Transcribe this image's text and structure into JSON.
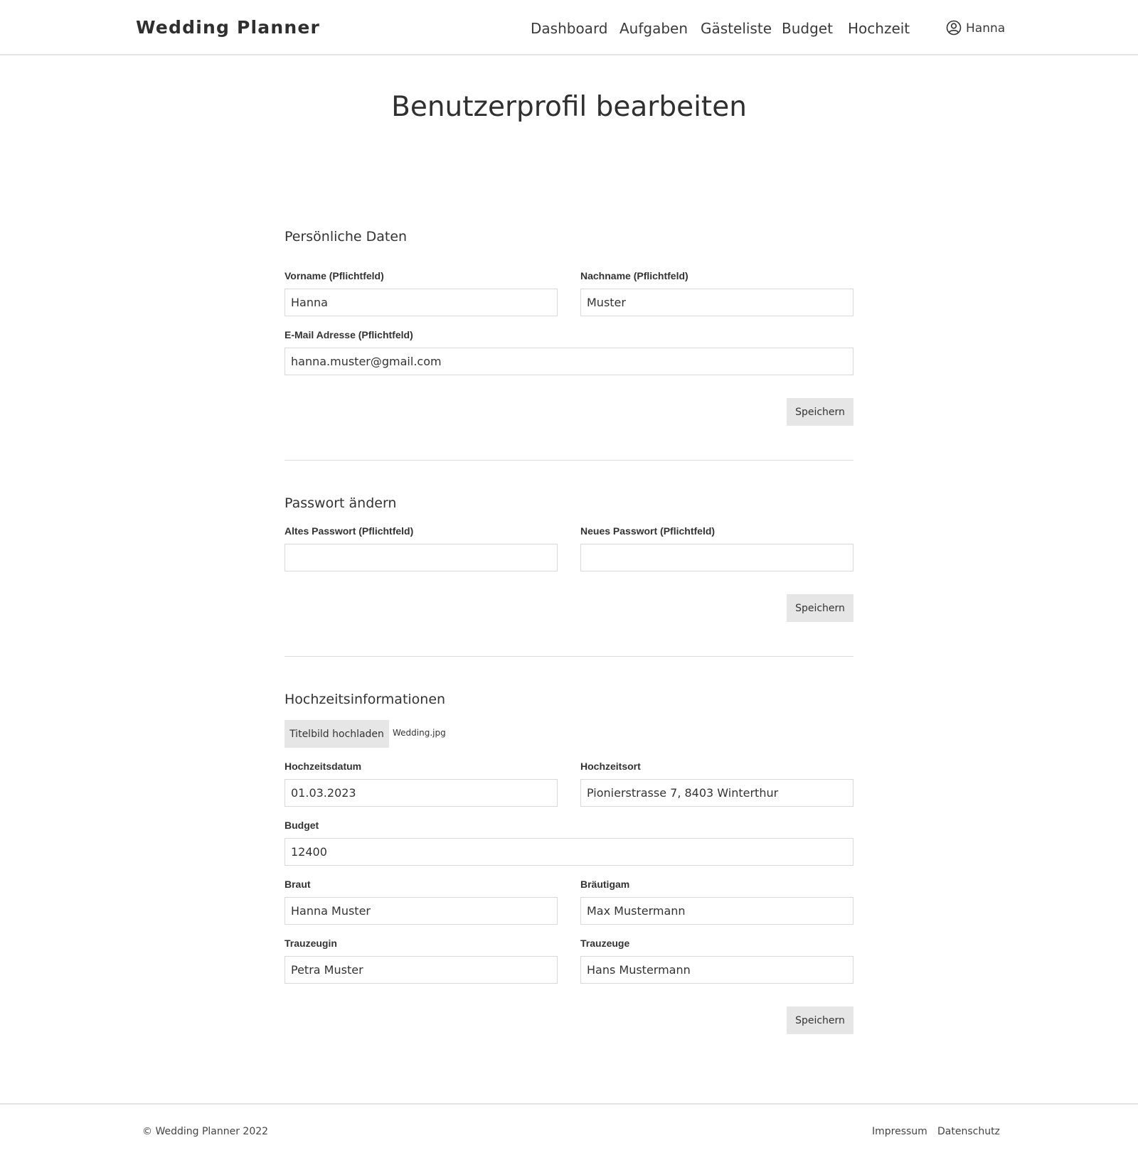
{
  "header": {
    "brand": "Wedding Planner",
    "nav": [
      "Dashboard",
      "Aufgaben",
      "Gästeliste",
      "Budget",
      "Hochzeit"
    ],
    "user_name": "Hanna",
    "user_icon": "user-circle-icon"
  },
  "page_title": "Benutzerprofil bearbeiten",
  "personal": {
    "title": "Persönliche Daten",
    "firstname_label": "Vorname (Pflichtfeld)",
    "firstname_value": "Hanna",
    "lastname_label": "Nachname (Pflichtfeld)",
    "lastname_value": "Muster",
    "email_label": "E-Mail Adresse (Pflichtfeld)",
    "email_value": "hanna.muster@gmail.com",
    "save_label": "Speichern"
  },
  "password": {
    "title": "Passwort ändern",
    "old_label": "Altes Passwort (Pflichtfeld)",
    "old_value": "",
    "new_label": "Neues Passwort (Pflichtfeld)",
    "new_value": "",
    "save_label": "Speichern"
  },
  "wedding": {
    "title": "Hochzeitsinformationen",
    "upload_label": "Titelbild hochladen",
    "upload_filename": "Wedding.jpg",
    "date_label": "Hochzeitsdatum",
    "date_value": "01.03.2023",
    "location_label": "Hochzeitsort",
    "location_value": "Pionierstrasse 7, 8403 Winterthur",
    "budget_label": "Budget",
    "budget_value": "12400",
    "bride_label": "Braut",
    "bride_value": "Hanna Muster",
    "groom_label": "Bräutigam",
    "groom_value": "Max Mustermann",
    "bridesmaid_label": "Trauzeugin",
    "bridesmaid_value": "Petra Muster",
    "bestman_label": "Trauzeuge",
    "bestman_value": "Hans Mustermann",
    "save_label": "Speichern"
  },
  "footer": {
    "copyright": "© Wedding Planner 2022",
    "impressum": "Impressum",
    "datenschutz": "Datenschutz"
  },
  "colors": {
    "button_bg": "#e6e6e6",
    "border": "#d9d9d9",
    "text": "#333333"
  }
}
